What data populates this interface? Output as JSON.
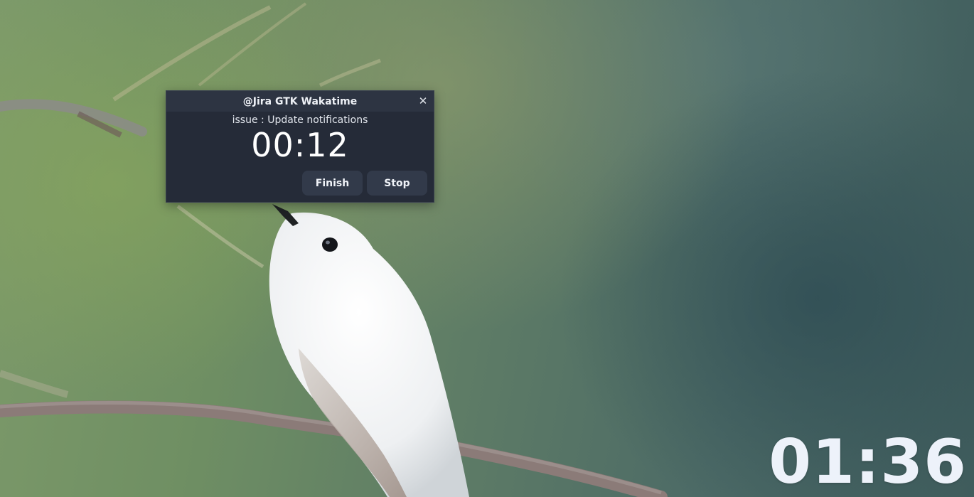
{
  "window": {
    "title": "@Jira GTK Wakatime",
    "close_glyph": "✕",
    "issue_label": "issue : Update notifications",
    "elapsed": "00:12",
    "buttons": {
      "finish": "Finish",
      "stop": "Stop"
    }
  },
  "desktop": {
    "clock": "01:36",
    "wallpaper": "white-hummingbird-on-branch"
  },
  "colors": {
    "window_bg": "#252b38",
    "titlebar_bg": "#2d3442",
    "button_bg": "#323a4a",
    "clock_text": "#edf2fa"
  }
}
